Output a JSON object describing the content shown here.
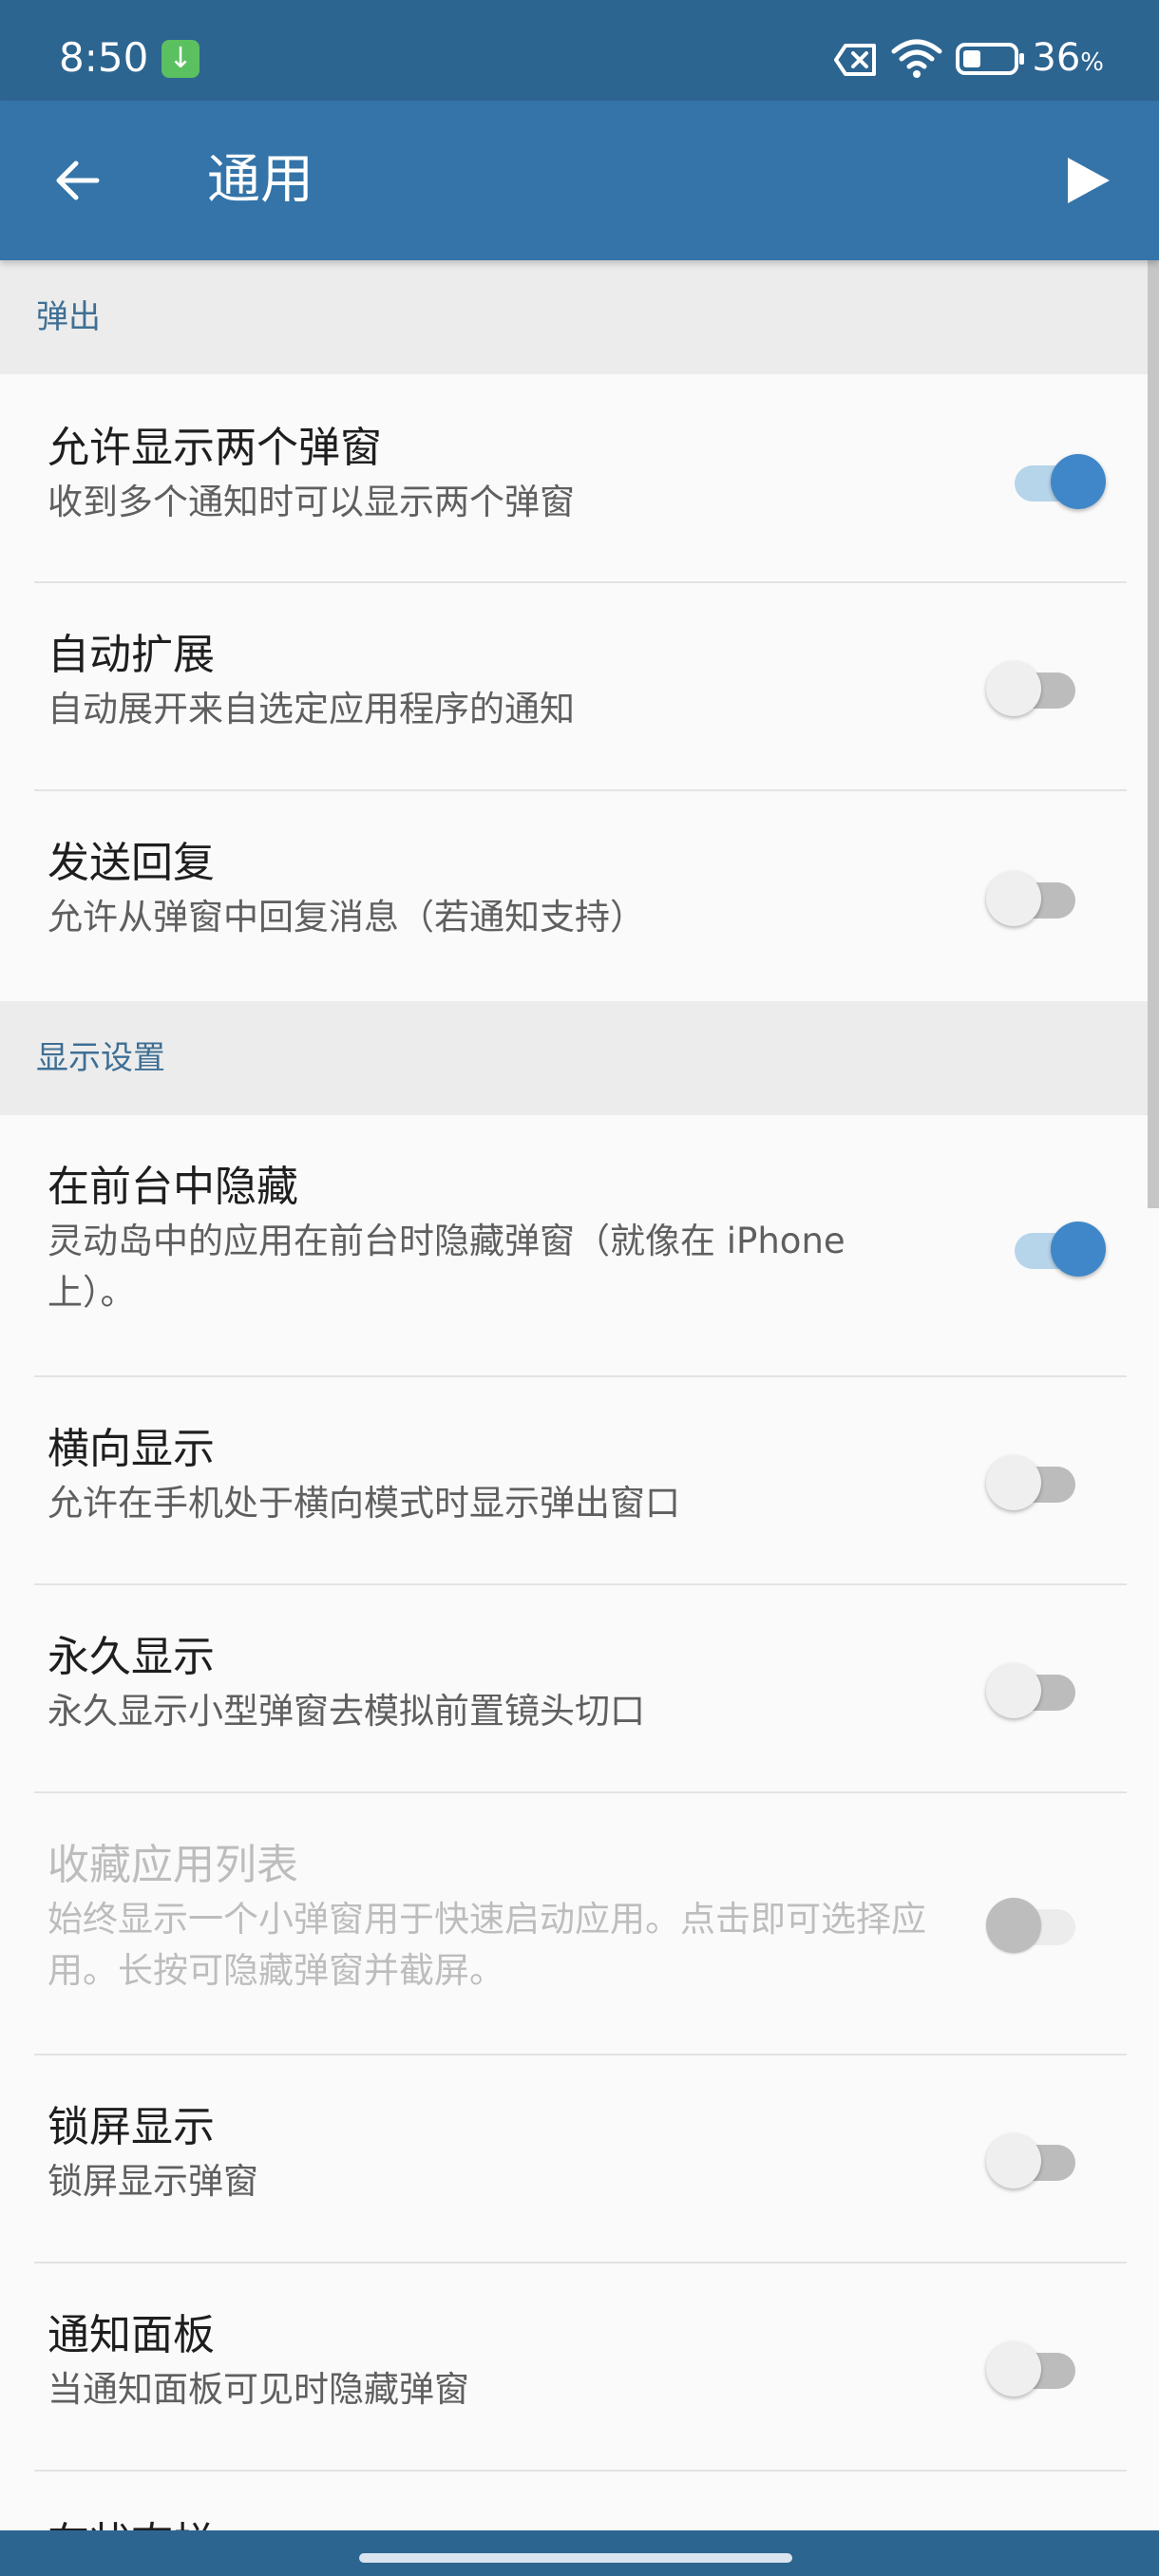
{
  "status_bar": {
    "time": "8:50",
    "battery_percent": "36",
    "battery_unit": "%"
  },
  "app_bar": {
    "title": "通用"
  },
  "sections": [
    {
      "header": "弹出",
      "items": [
        {
          "title": "允许显示两个弹窗",
          "subtitle": "收到多个通知时可以显示两个弹窗",
          "on": true
        },
        {
          "title": "自动扩展",
          "subtitle": "自动展开来自选定应用程序的通知",
          "on": false
        },
        {
          "title": "发送回复",
          "subtitle": "允许从弹窗中回复消息（若通知支持）",
          "on": false
        }
      ]
    },
    {
      "header": "显示设置",
      "items": [
        {
          "title": "在前台中隐藏",
          "subtitle": "灵动岛中的应用在前台时隐藏弹窗（就像在 iPhone 上）。",
          "on": true
        },
        {
          "title": "横向显示",
          "subtitle": "允许在手机处于横向模式时显示弹出窗口",
          "on": false
        },
        {
          "title": "永久显示",
          "subtitle": "永久显示小型弹窗去模拟前置镜头切口",
          "on": false
        },
        {
          "title": "收藏应用列表",
          "subtitle": "始终显示一个小弹窗用于快速启动应用。点击即可选择应用。长按可隐藏弹窗并截屏。",
          "on": false,
          "disabled": true
        },
        {
          "title": "锁屏显示",
          "subtitle": "锁屏显示弹窗",
          "on": false
        },
        {
          "title": "通知面板",
          "subtitle": "当通知面板可见时隐藏弹窗",
          "on": false
        }
      ]
    }
  ],
  "partial_item_title": "在状态栏"
}
